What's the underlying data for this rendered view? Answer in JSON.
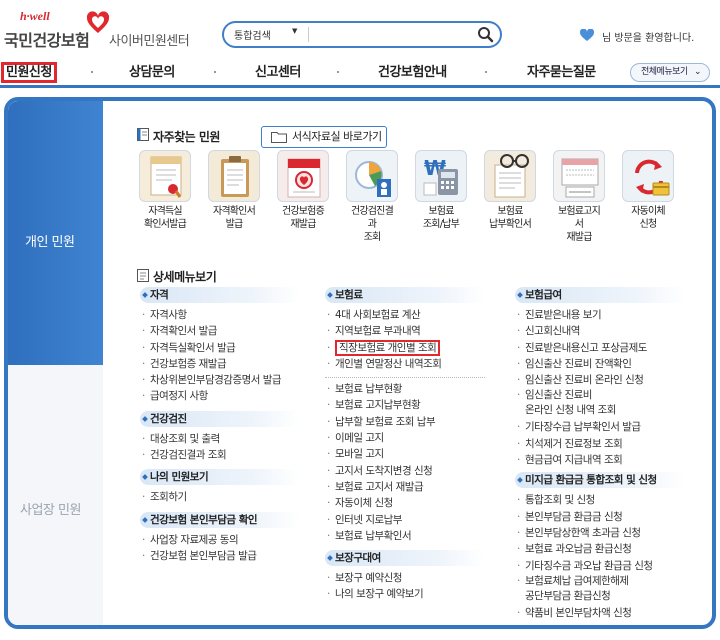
{
  "header": {
    "logo_top": "h·well",
    "logo_main": "국민건강보험",
    "logo_sub": "사이버민원센터",
    "search": {
      "select_value": "통합검색",
      "placeholder": ""
    },
    "welcome": "님 방문을 환영합니다."
  },
  "nav": {
    "items": [
      "민원신청",
      "상담문의",
      "신고센터",
      "건강보험안내",
      "자주묻는질문"
    ],
    "all_menu": "전체메뉴보기"
  },
  "left_tabs": {
    "personal": "개인 민원",
    "business": "사업장 민원"
  },
  "favorites": {
    "title": "자주찾는 민원",
    "doc_button": "서식자료실 바로가기",
    "items": [
      {
        "label": "자격득실\n확인서발급",
        "icon": "certificate-icon"
      },
      {
        "label": "자격확인서\n발급",
        "icon": "clipboard-icon"
      },
      {
        "label": "건강보험증\n재발급",
        "icon": "insurance-card-icon"
      },
      {
        "label": "건강검진결\n과\n조회",
        "icon": "checkup-chart-icon"
      },
      {
        "label": "보험료\n조회/납부",
        "icon": "won-calculator-icon"
      },
      {
        "label": "보험료\n납부확인서",
        "icon": "receipt-glasses-icon"
      },
      {
        "label": "보험료고지\n서\n재발급",
        "icon": "bill-notice-icon"
      },
      {
        "label": "자동이체\n신청",
        "icon": "auto-transfer-icon"
      }
    ]
  },
  "detail": {
    "title": "상세메뉴보기",
    "col1": {
      "cat_qualification": "자격",
      "qualification": [
        "자격사항",
        "자격확인서 발급",
        "자격득실확인서 발급",
        "건강보험증 재발급",
        "차상위본인부담경감증명서 발급",
        "급여정지 사항"
      ],
      "cat_checkup": "건강검진",
      "checkup": [
        "대상조회 및 출력",
        "건강검진결과 조회"
      ],
      "cat_mine": "나의 민원보기",
      "mine": [
        "조회하기"
      ],
      "cat_copay": "건강보험 본인부담금 확인",
      "copay": [
        "사업장 자료제공 동의",
        "건강보험 본인부담금 발급"
      ]
    },
    "col2": {
      "cat_premium": "보험료",
      "premium_a": [
        "4대 사회보험료 계산",
        "지역보험료 부과내역",
        "직장보험료 개인별 조회",
        "개인별 연말정산 내역조회"
      ],
      "premium_b": [
        "보험료 납부현황",
        "보험료 고지납부현황",
        "납부할 보험료 조회 납부",
        "이메일 고지",
        "모바일 고지",
        "고지서 도착지변경 신청",
        "보험료 고지서 재발급",
        "자동이체 신청",
        "인터넷 지로납부",
        "보험료 납부확인서"
      ],
      "cat_device": "보장구대여",
      "device": [
        "보장구 예약신청",
        "나의 보장구 예약보기"
      ]
    },
    "col3": {
      "cat_benefit": "보험급여",
      "benefit": [
        "진료받은내용 보기",
        "신고회신내역",
        "진료받은내용신고 포상금제도",
        "임신출산 진료비 잔액확인",
        "임신출산 진료비 온라인 신청",
        "임신출산 진료비\n온라인 신청 내역 조회",
        "기타장수급 납부확인서 발급",
        "치석제거 진료정보 조회",
        "현금급여 지급내역 조회"
      ],
      "cat_refund": "미지급 환급금 통합조회 및 신청",
      "refund": [
        "통합조회 및 신청",
        "본인부담금 환급금 신청",
        "본인부담상한액 초과금 신청",
        "보험료 과오납금 환급신청",
        "기타징수금 과오납 환급금 신청",
        "보험료체납 급여제한해제\n공단부담금 환급신청",
        "약품비 본인부담차액 신청"
      ]
    }
  }
}
